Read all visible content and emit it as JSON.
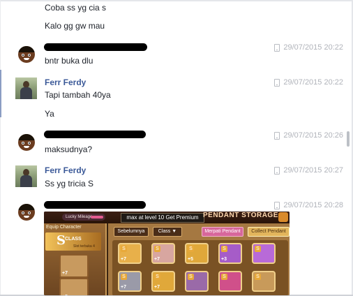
{
  "chat": {
    "messages": [
      {
        "text": "Coba ss yg cia s"
      },
      {
        "text": "Kalo gg gw mau"
      },
      {
        "text": "bntr buka dlu",
        "time": "29/07/2015 20:22"
      },
      {
        "sender": "Ferr Ferdy",
        "text": "Tapi tambah 40ya",
        "time": "29/07/2015 20:22"
      },
      {
        "text": "Ya"
      },
      {
        "text": "maksudnya?",
        "time": "29/07/2015 20:26"
      },
      {
        "sender": "Ferr Ferdy",
        "text": "Ss yg tricia S",
        "time": "29/07/2015 20:27"
      },
      {
        "time": "29/07/2015 20:28"
      }
    ]
  },
  "game": {
    "mileage_label": "Lucky Mileage",
    "premium_banner": "max at level 10 Get Premium",
    "storage_title": "PENDANT STORAGE",
    "equip_label": "Equip Character",
    "class_letter": "S",
    "class_word": "CLASS",
    "slot_label": "Slot terbuka 4",
    "btn_prev": "Sebelumnya",
    "btn_class": "Class ▼",
    "btn_merge": "Merpati Pendant",
    "btn_collect": "Collect Pendant",
    "slot_badges": [
      "+7",
      "+5"
    ],
    "items_row1": [
      "+7",
      "+7",
      "+5",
      "+3",
      ""
    ],
    "items_row2": [
      "+7",
      "+7",
      "",
      "",
      ""
    ]
  },
  "colors": {
    "sender_name": "#3b5998",
    "timestamp": "#b0b3ba",
    "message_text": "#1d2129"
  }
}
